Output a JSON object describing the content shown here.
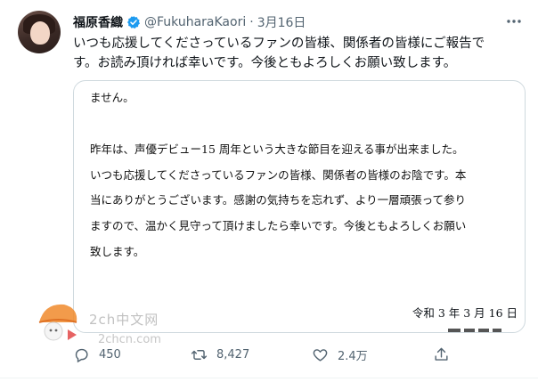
{
  "tweet": {
    "display_name": "福原香織",
    "handle": "@FukuharaKaori",
    "separator": "·",
    "date": "3月16日",
    "text_lines": [
      "いつも応援してくださっているファンの皆様、関係者の皆様にご報告で",
      "す。お読み頂ければ幸いです。今後ともよろしくお願い致します。"
    ]
  },
  "image": {
    "lines": [
      "ません。",
      "昨年は、声優デビュー15 周年という大きな節目を迎える事が出来ました。",
      "いつも応援してくださっているファンの皆様、関係者の皆様のお陰です。本",
      "当にありがとうございます。感謝の気持ちを忘れず、より一層頑張って参り",
      "ますので、温かく見守って頂けましたら幸いです。今後ともよろしくお願い",
      "致します。"
    ],
    "date": "令和 3 年 3 月 16 日"
  },
  "watermark": {
    "text1": "2ch中文网",
    "text2": "2chcn.com"
  },
  "actions": {
    "reply_count": "450",
    "retweet_count": "8,427",
    "like_count": "2.4万"
  },
  "colors": {
    "verified": "#1d9bf0",
    "muted": "#536471",
    "border": "#cfd9de"
  }
}
